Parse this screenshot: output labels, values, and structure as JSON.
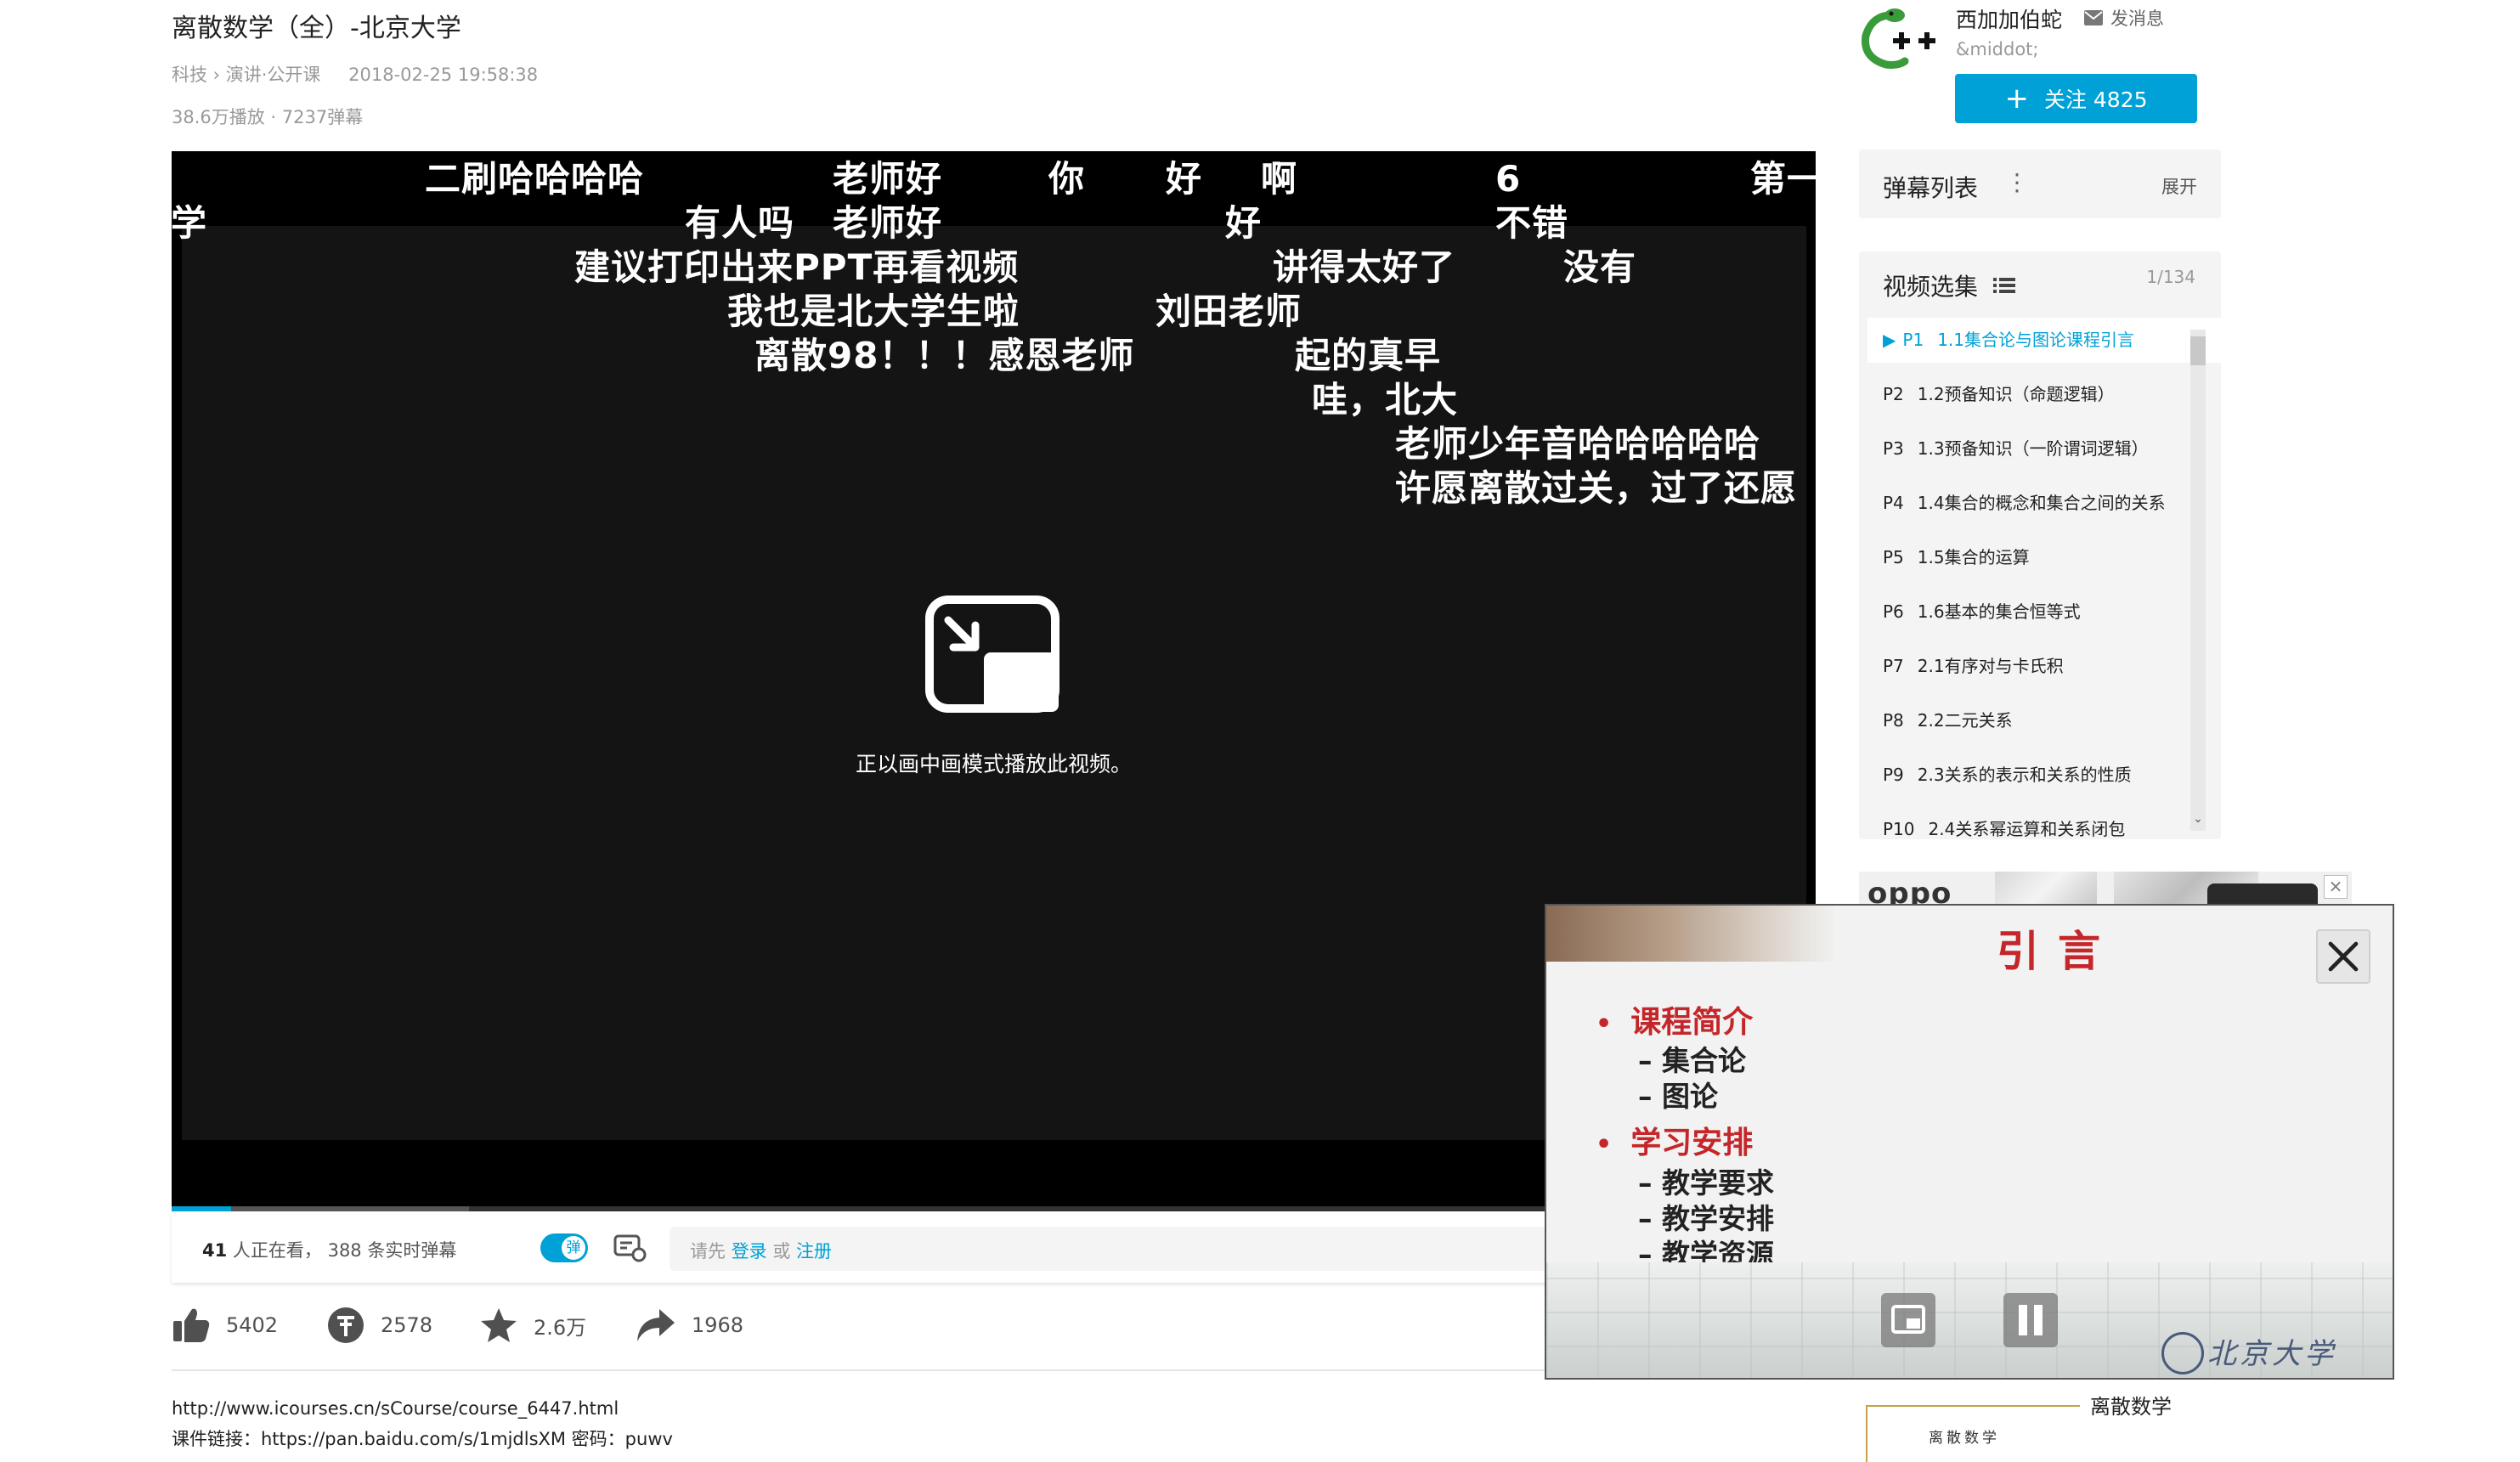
{
  "video": {
    "title": "离散数学（全）-北京大学",
    "category": "科技 › 演讲·公开课",
    "date": "2018-02-25 19:58:38",
    "stats": "38.6万播放 · 7237弹幕"
  },
  "player": {
    "pip_message": "正以画中画模式播放此视频。",
    "danmaku": [
      {
        "text": "二刷哈哈哈哈"
      },
      {
        "text": "老师好"
      },
      {
        "text": "你"
      },
      {
        "text": "好"
      },
      {
        "text": "啊"
      },
      {
        "text": "6"
      },
      {
        "text": "第一"
      },
      {
        "text": "大学"
      },
      {
        "text": "有人吗"
      },
      {
        "text": "老师好"
      },
      {
        "text": "好"
      },
      {
        "text": "不错"
      },
      {
        "text": "建议打印出来PPT再看视频"
      },
      {
        "text": "讲得太好了"
      },
      {
        "text": "没有"
      },
      {
        "text": "我也是北大学生啦"
      },
      {
        "text": "刘田老师"
      },
      {
        "text": "离散98！！！感恩老师"
      },
      {
        "text": "起的真早"
      },
      {
        "text": "哇，北大"
      },
      {
        "text": "老师少年音哈哈哈哈哈"
      },
      {
        "text": "许愿离散过关，过了还愿"
      }
    ]
  },
  "sendbar": {
    "viewers_count": "41",
    "viewers_text": " 人正在看，  388 条实时弹幕",
    "toggle_label": "弹",
    "input_prefix": "请先 ",
    "login_link": "登录",
    "or_text": " 或 ",
    "register_link": "注册"
  },
  "actions": {
    "like": "5402",
    "coin": "2578",
    "favorite": "2.6万",
    "share": "1968"
  },
  "description": {
    "line1": "http://www.icourses.cn/sCourse/course_6447.html",
    "line2": "课件链接：https://pan.baidu.com/s/1mjdlsXM 密码：puwv"
  },
  "uploader": {
    "name": "西加加伯蛇",
    "message": "发消息",
    "sign": "&middot;",
    "follow": "关注 4825"
  },
  "danmaku_list": {
    "title": "弹幕列表",
    "expand": "展开"
  },
  "episodes": {
    "title": "视频选集",
    "count": "1/134",
    "items": [
      {
        "no": "P1",
        "title": "1.1集合论与图论课程引言"
      },
      {
        "no": "P2",
        "title": "1.2预备知识（命题逻辑）"
      },
      {
        "no": "P3",
        "title": "1.3预备知识（一阶谓词逻辑）"
      },
      {
        "no": "P4",
        "title": "1.4集合的概念和集合之间的关系"
      },
      {
        "no": "P5",
        "title": "1.5集合的运算"
      },
      {
        "no": "P6",
        "title": "1.6基本的集合恒等式"
      },
      {
        "no": "P7",
        "title": "2.1有序对与卡氏积"
      },
      {
        "no": "P8",
        "title": "2.2二元关系"
      },
      {
        "no": "P9",
        "title": "2.3关系的表示和关系的性质"
      },
      {
        "no": "P10",
        "title": "2.4关系幂运算和关系闭包"
      }
    ]
  },
  "ad": {
    "brand": "oppo",
    "close": "×"
  },
  "pip_window": {
    "slide_title": "引言",
    "sections": [
      {
        "heading": "课程简介",
        "items": [
          "– 集合论",
          "– 图论"
        ]
      },
      {
        "heading": "学习安排",
        "items": [
          "– 教学要求",
          "– 教学安排",
          "– 教学资源"
        ]
      }
    ],
    "logo": "北京大学"
  },
  "recommend": {
    "course_name": "离散数学",
    "book_label": "离散数学"
  },
  "colors": {
    "accent": "#00a1d6",
    "slide_red": "#c4262a"
  }
}
